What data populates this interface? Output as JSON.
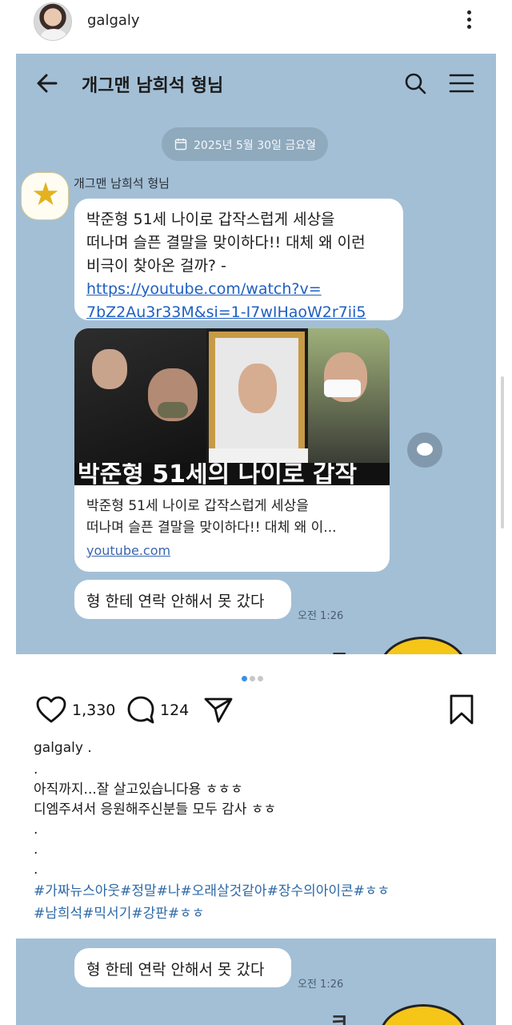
{
  "post": {
    "username": "galgaly"
  },
  "chat": {
    "title": "개그맨 남희석 형님",
    "date": "2025년 5월 30일 금요일",
    "date_chevron": "›",
    "sender": "개그맨 남희석 형님",
    "message1_lines": [
      "박준형 51세 나이로 갑작스럽게 세상을",
      "떠나며 슬픈 결말을 맞이하다!! 대체 왜 이런",
      "비극이 찾아온 걸까? -"
    ],
    "message1_link_lines": [
      "https://youtube.com/watch?v=",
      "7bZ2Au3r33M&si=1-I7wIHaoW2r7ii5"
    ],
    "preview": {
      "thumbnail_caption": "박준형 51세의 나이로 갑작",
      "title_lines": [
        "박준형 51세 나이로 갑작스럽게 세상을",
        "떠나며 슬픈 결말을 맞이하다!! 대체 왜 이..."
      ],
      "domain": "youtube.com"
    },
    "message2": "형 한테 연락 안해서 못 갔다",
    "time": "오전 1:26",
    "sticker_text": "ㅋ"
  },
  "actions": {
    "likes": "1,330",
    "comments": "124"
  },
  "caption": {
    "user": "galgaly .",
    "lines": [
      ".",
      "아직까지...잘 살고있습니다용 ㅎㅎㅎ",
      "디엠주셔서 응원해주신분들 모두 감사 ㅎㅎ",
      ".",
      ".",
      "."
    ],
    "hashtags": [
      "#가짜뉴스아웃#정말#나#오래살것같아#장수의아이콘#ㅎㅎ",
      "#남희석#믹서기#강판#ㅎㅎ"
    ]
  },
  "chat2": {
    "message": "형 한테 연락 안해서 못 갔다",
    "time": "오전 1:26",
    "sticker_text": "ㅋ"
  },
  "colors": {
    "chat_bg": "#a3bfd6",
    "link": "#1f5fc2",
    "hashtag": "#2e6aa7",
    "dot_active": "#3b8fe6"
  }
}
